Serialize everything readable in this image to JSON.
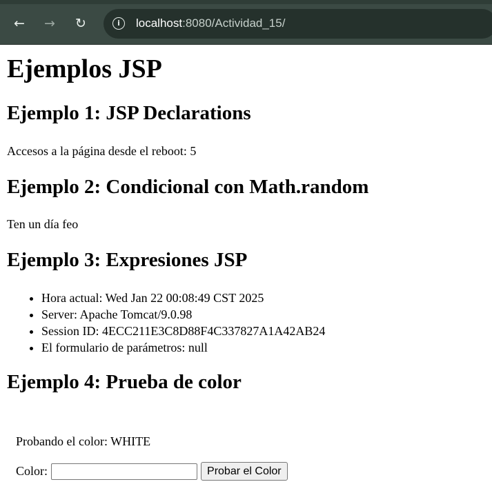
{
  "browser": {
    "back_icon": "←",
    "forward_icon": "→",
    "reload_icon": "↻",
    "info_icon": "i",
    "url_host": "localhost",
    "url_rest": ":8080/Actividad_15/"
  },
  "page": {
    "title": "Ejemplos JSP",
    "ex1": {
      "heading": "Ejemplo 1: JSP Declarations",
      "text": "Accesos a la página desde el reboot: 5"
    },
    "ex2": {
      "heading": "Ejemplo 2: Condicional con Math.random",
      "text": "Ten un día feo"
    },
    "ex3": {
      "heading": "Ejemplo 3: Expresiones JSP",
      "items": [
        "Hora actual: Wed Jan 22 00:08:49 CST 2025",
        "Server: Apache Tomcat/9.0.98",
        "Session ID: 4ECC211E3C8D88F4C337827A1A42AB24",
        "El formulario de parámetros: null"
      ]
    },
    "ex4": {
      "heading": "Ejemplo 4: Prueba de color",
      "text": "Probando el color: WHITE",
      "color_label": "Color:",
      "color_value": "",
      "submit_label": "Probar el Color"
    }
  }
}
